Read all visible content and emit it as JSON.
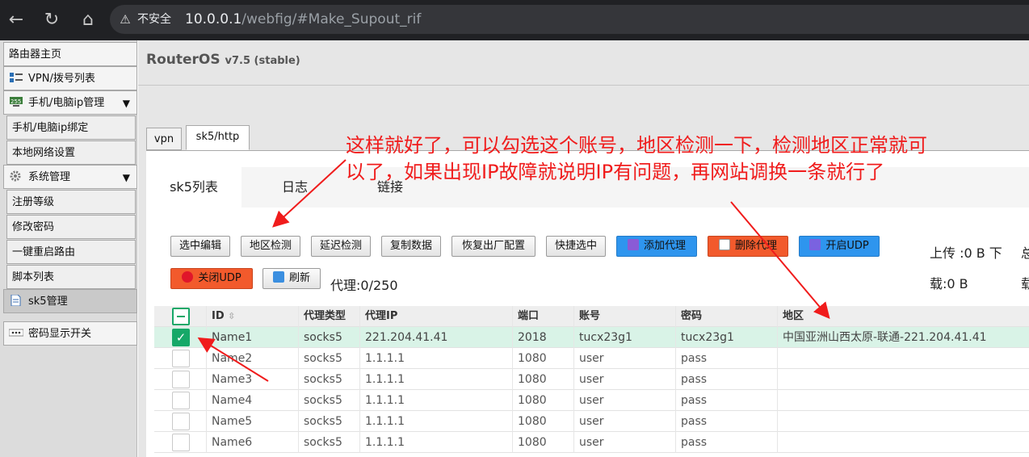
{
  "browser": {
    "security_label": "不安全",
    "url_host": "10.0.0.1",
    "url_path": "/webfig/#Make_Supout_rif"
  },
  "sidebar": {
    "items": [
      {
        "label": "路由器主页"
      },
      {
        "label": "VPN/拨号列表"
      },
      {
        "label": "手机/电脑ip管理"
      },
      {
        "label": "手机/电脑ip绑定"
      },
      {
        "label": "本地网络设置"
      },
      {
        "label": "系统管理"
      },
      {
        "label": "注册等级"
      },
      {
        "label": "修改密码"
      },
      {
        "label": "一键重启路由"
      },
      {
        "label": "脚本列表"
      },
      {
        "label": "sk5管理"
      },
      {
        "label": "密码显示开关"
      }
    ]
  },
  "header": {
    "app_name": "RouterOS",
    "version": "v7.5 (stable)"
  },
  "panel_tabs": [
    "vpn",
    "sk5/http"
  ],
  "sub_tabs": [
    "sk5列表",
    "日志",
    "链接"
  ],
  "toolbar": {
    "edit_selected": "选中编辑",
    "region_check": "地区检测",
    "latency_check": "延迟检测",
    "copy_data": "复制数据",
    "factory_reset": "恢复出厂配置",
    "quick_select": "快捷选中",
    "add_proxy": "添加代理",
    "delete_proxy": "删除代理",
    "enable_udp": "开启UDP",
    "disable_udp": "关闭UDP",
    "refresh": "刷新",
    "proxy_count": "代理:0/250",
    "upload_stat": "上传 :0 B 下",
    "download_stat": "载:0 B",
    "total_cut_1": "总",
    "total_cut_2": "载"
  },
  "table": {
    "headers": [
      "ID",
      "代理类型",
      "代理IP",
      "端口",
      "账号",
      "密码",
      "地区"
    ],
    "rows": [
      {
        "checked": true,
        "id": "Name1",
        "type": "socks5",
        "ip": "221.204.41.41",
        "port": "2018",
        "user": "tucx23g1",
        "pass": "tucx23g1",
        "region": "中国亚洲山西太原-联通-221.204.41.41"
      },
      {
        "checked": false,
        "id": "Name2",
        "type": "socks5",
        "ip": "1.1.1.1",
        "port": "1080",
        "user": "user",
        "pass": "pass",
        "region": ""
      },
      {
        "checked": false,
        "id": "Name3",
        "type": "socks5",
        "ip": "1.1.1.1",
        "port": "1080",
        "user": "user",
        "pass": "pass",
        "region": ""
      },
      {
        "checked": false,
        "id": "Name4",
        "type": "socks5",
        "ip": "1.1.1.1",
        "port": "1080",
        "user": "user",
        "pass": "pass",
        "region": ""
      },
      {
        "checked": false,
        "id": "Name5",
        "type": "socks5",
        "ip": "1.1.1.1",
        "port": "1080",
        "user": "user",
        "pass": "pass",
        "region": ""
      },
      {
        "checked": false,
        "id": "Name6",
        "type": "socks5",
        "ip": "1.1.1.1",
        "port": "1080",
        "user": "user",
        "pass": "pass",
        "region": ""
      }
    ]
  },
  "annotation": {
    "line1": "这样就好了，可以勾选这个账号，地区检测一下，检测地区正常就可",
    "line2": "以了，如果出现IP故障就说明IP有问题，再网站调换一条就行了"
  },
  "colors": {
    "annotation": "#f01c1c",
    "row_highlight": "#d9f3e7",
    "check_green": "#16a868",
    "blue_button": "#2e95ee",
    "orange_button": "#f25a2c"
  }
}
